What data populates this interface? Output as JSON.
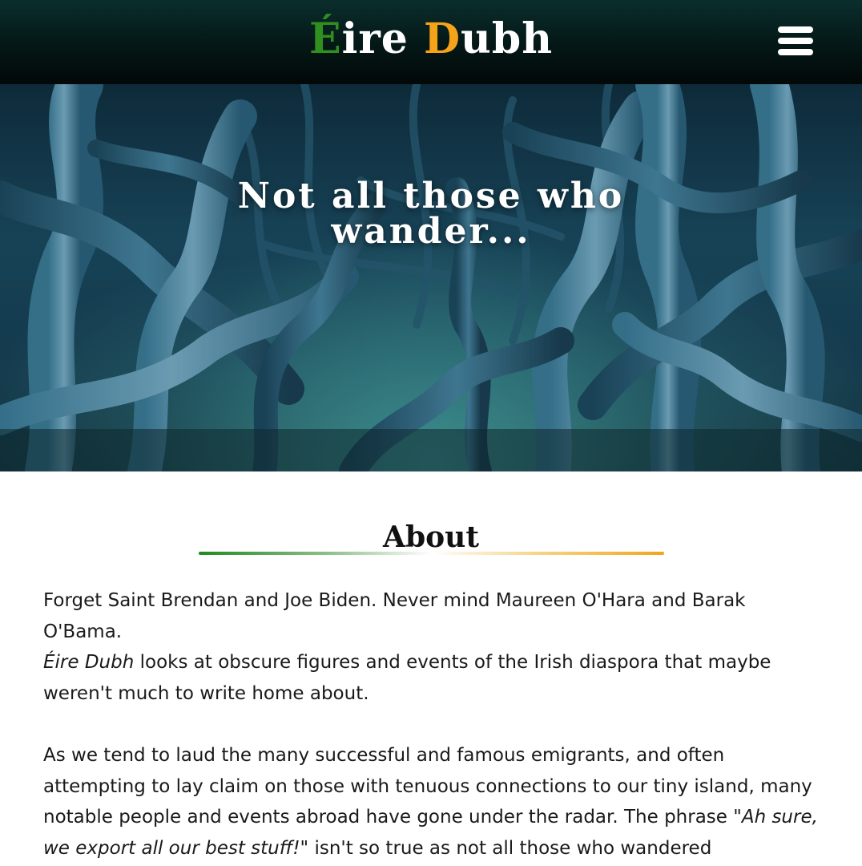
{
  "header": {
    "logo": {
      "part_a_initial": "É",
      "part_a_rest": "ire",
      "part_b_initial": "D",
      "part_b_rest": "ubh"
    },
    "menu_icon": "hamburger-menu-icon"
  },
  "hero": {
    "caption": "Not all those who wander..."
  },
  "about": {
    "title": "About",
    "paragraph_1": {
      "line_1": "Forget Saint Brendan and Joe Biden. Never mind Maureen O'Hara and Barak O'Bama.",
      "emphasis": "Éire Dubh",
      "line_2": " looks at obscure figures and events of the Irish diaspora that maybe weren't much to write home about."
    },
    "paragraph_2": {
      "text_before": "As we tend to laud the many successful and famous emigrants, and often attempting to lay claim on those with tenuous connections to our tiny island, many notable people and events abroad have gone under the radar. The phrase ",
      "quote": "\"Ah sure, we export all our best stuff!\"",
      "text_after": " isn't so true as not all those who wandered"
    }
  },
  "colors": {
    "header_dark": "#041716",
    "logo_green": "#2f8f1f",
    "logo_orange": "#f5a319",
    "divider_green": "#1f8a1f",
    "divider_orange": "#f2a51a",
    "hero_teal": "#1a4a60"
  }
}
